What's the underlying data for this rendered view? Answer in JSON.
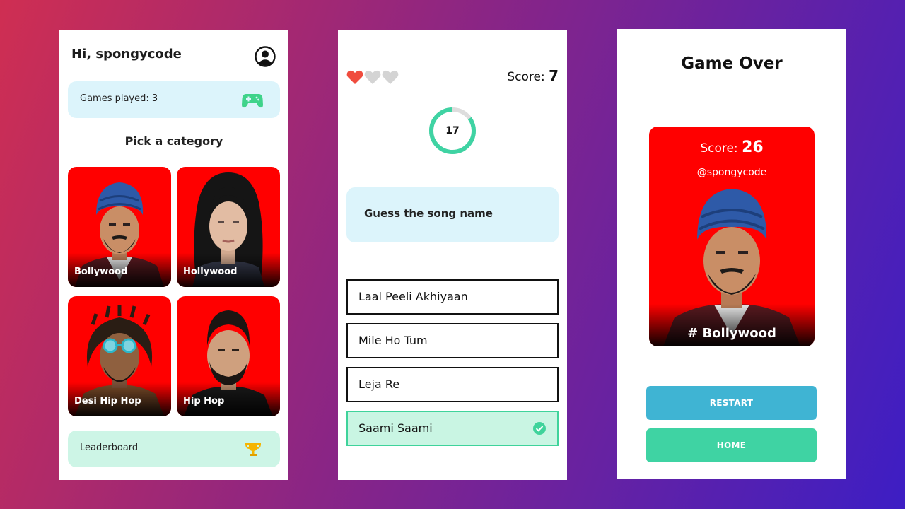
{
  "home": {
    "greeting": "Hi, spongycode",
    "games_played": "Games played: 3",
    "pick_title": "Pick a category",
    "categories": [
      {
        "label": "Bollywood"
      },
      {
        "label": "Hollywood"
      },
      {
        "label": "Desi Hip Hop"
      },
      {
        "label": "Hip Hop"
      }
    ],
    "leaderboard": "Leaderboard",
    "icons": {
      "profile": "account-circle-icon",
      "games": "gamepad-icon",
      "leaderboard": "trophy-icon"
    },
    "colors": {
      "card_blue": "#dcf4fb",
      "card_green": "#cdf5e6",
      "category_bg": "#ff0000",
      "gamepad": "#3fd38a",
      "trophy": "#f5b400"
    }
  },
  "quiz": {
    "lives_total": 3,
    "lives_remaining": 1,
    "score_label": "Score: ",
    "score_value": "7",
    "timer_value": "17",
    "timer_fraction_remaining": 0.85,
    "question": "Guess the song name",
    "options": [
      "Laal Peeli Akhiyaan",
      "Mile Ho Tum",
      "Leja Re",
      "Saami Saami"
    ],
    "selected_option_index": 3,
    "icons": {
      "life_full": "heart-icon",
      "life_empty": "heart-outline-icon",
      "correct": "check-circle-icon"
    },
    "colors": {
      "heart_full": "#f04c3e",
      "heart_empty": "#d4d4d4",
      "timer": "#3fd3a3",
      "timer_track": "#dddddd",
      "correct": "#3fd39b"
    }
  },
  "game_over": {
    "title": "Game Over",
    "score_label": "Score: ",
    "score_value": "26",
    "username": "@spongycode",
    "category": "# Bollywood",
    "restart_label": "RESTART",
    "home_label": "HOME",
    "colors": {
      "restart": "#3fb4d3",
      "home": "#3fd3a3"
    }
  }
}
